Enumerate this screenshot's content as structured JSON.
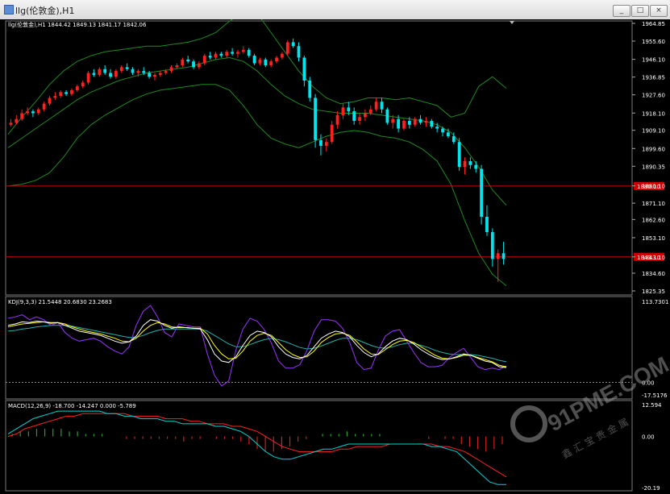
{
  "window": {
    "title": "llg(伦敦金),H1",
    "buttons": [
      "_",
      "□",
      "×"
    ]
  },
  "colors": {
    "background": "#000000",
    "bull": "#ff2020",
    "bear": "#00e5ee",
    "bands": "#1f8a1f",
    "hline": "#cc0000",
    "kdj_k": "#ffffff",
    "kdj_d": "#ffff00",
    "kdj_j": "#9a33ff",
    "kdj_m": "#20b2aa",
    "macd_line": "#00d4d4",
    "macd_signal": "#ff2020",
    "hist_pos": "#2e9a2e",
    "hist_neg": "#cc1f1f"
  },
  "main": {
    "label": "llg(伦敦金),H1  1844.42 1849.13 1841.17 1842.06",
    "hlines": [
      {
        "value": 1880,
        "tag": "1880.10"
      },
      {
        "value": 1843.1,
        "tag": "1843.10"
      }
    ]
  },
  "kdj": {
    "label": "KDJ(9,3,3) 21.5448 20.6830 23.2683"
  },
  "macd": {
    "label": "MACD(12,26,9) -18.700 -14.247 0.000 -5.789"
  },
  "watermark": {
    "text": "91PME.COM",
    "subtext": "鑫 汇 宝 贵 金 属"
  },
  "chart_data": [
    {
      "type": "candlestick",
      "title": "llg(伦敦金),H1",
      "ylim": [
        1825.35,
        1964.85
      ],
      "ticks": [
        1964.85,
        1955.6,
        1946.1,
        1936.85,
        1927.6,
        1918.1,
        1909.1,
        1899.6,
        1890.35,
        1880.1,
        1871.1,
        1862.6,
        1853.1,
        1843.1,
        1834.6,
        1825.35
      ],
      "ohlc": [
        [
          1912,
          1915,
          1911,
          1913
        ],
        [
          1913,
          1917,
          1912,
          1915
        ],
        [
          1915,
          1920,
          1914,
          1918
        ],
        [
          1918,
          1921,
          1917,
          1919
        ],
        [
          1919,
          1920,
          1916,
          1918
        ],
        [
          1918,
          1921,
          1917,
          1920
        ],
        [
          1920,
          1924,
          1919,
          1923
        ],
        [
          1923,
          1927,
          1922,
          1926
        ],
        [
          1926,
          1929,
          1925,
          1927
        ],
        [
          1927,
          1930,
          1926,
          1929
        ],
        [
          1929,
          1930,
          1927,
          1928
        ],
        [
          1928,
          1931,
          1927,
          1930
        ],
        [
          1930,
          1933,
          1929,
          1932
        ],
        [
          1932,
          1935,
          1931,
          1934
        ],
        [
          1934,
          1940,
          1933,
          1939
        ],
        [
          1939,
          1941,
          1937,
          1938
        ],
        [
          1938,
          1942,
          1937,
          1941
        ],
        [
          1941,
          1943,
          1938,
          1939
        ],
        [
          1939,
          1941,
          1936,
          1937
        ],
        [
          1937,
          1941,
          1936,
          1940
        ],
        [
          1940,
          1943,
          1939,
          1942
        ],
        [
          1942,
          1944,
          1940,
          1941
        ],
        [
          1941,
          1942,
          1938,
          1939
        ],
        [
          1939,
          1941,
          1937,
          1940
        ],
        [
          1940,
          1942,
          1938,
          1939
        ],
        [
          1939,
          1940,
          1936,
          1937
        ],
        [
          1937,
          1939,
          1935,
          1938
        ],
        [
          1938,
          1940,
          1937,
          1939
        ],
        [
          1939,
          1941,
          1938,
          1940
        ],
        [
          1940,
          1943,
          1939,
          1942
        ],
        [
          1942,
          1944,
          1941,
          1943
        ],
        [
          1943,
          1947,
          1942,
          1946
        ],
        [
          1946,
          1948,
          1944,
          1945
        ],
        [
          1945,
          1946,
          1941,
          1942
        ],
        [
          1942,
          1945,
          1941,
          1944
        ],
        [
          1944,
          1949,
          1943,
          1948
        ],
        [
          1948,
          1950,
          1946,
          1947
        ],
        [
          1947,
          1950,
          1946,
          1949
        ],
        [
          1949,
          1950,
          1947,
          1948
        ],
        [
          1948,
          1951,
          1947,
          1950
        ],
        [
          1950,
          1952,
          1948,
          1949
        ],
        [
          1949,
          1951,
          1947,
          1950
        ],
        [
          1950,
          1953,
          1949,
          1951
        ],
        [
          1951,
          1952,
          1947,
          1948
        ],
        [
          1948,
          1949,
          1943,
          1944
        ],
        [
          1944,
          1947,
          1943,
          1946
        ],
        [
          1946,
          1947,
          1942,
          1943
        ],
        [
          1943,
          1946,
          1942,
          1945
        ],
        [
          1945,
          1948,
          1944,
          1947
        ],
        [
          1947,
          1950,
          1946,
          1949
        ],
        [
          1949,
          1956,
          1948,
          1955
        ],
        [
          1955,
          1957,
          1952,
          1953
        ],
        [
          1953,
          1955,
          1945,
          1947
        ],
        [
          1947,
          1948,
          1932,
          1935
        ],
        [
          1935,
          1937,
          1924,
          1926
        ],
        [
          1926,
          1928,
          1900,
          1904
        ],
        [
          1904,
          1907,
          1896,
          1901
        ],
        [
          1901,
          1905,
          1898,
          1903
        ],
        [
          1903,
          1914,
          1902,
          1912
        ],
        [
          1912,
          1919,
          1910,
          1917
        ],
        [
          1917,
          1923,
          1915,
          1921
        ],
        [
          1921,
          1924,
          1917,
          1919
        ],
        [
          1919,
          1921,
          1912,
          1914
        ],
        [
          1914,
          1918,
          1912,
          1916
        ],
        [
          1916,
          1920,
          1914,
          1918
        ],
        [
          1918,
          1922,
          1917,
          1920
        ],
        [
          1920,
          1926,
          1919,
          1924
        ],
        [
          1924,
          1926,
          1918,
          1920
        ],
        [
          1920,
          1921,
          1912,
          1913
        ],
        [
          1913,
          1917,
          1910,
          1915
        ],
        [
          1915,
          1917,
          1908,
          1910
        ],
        [
          1910,
          1915,
          1909,
          1914
        ],
        [
          1914,
          1916,
          1910,
          1912
        ],
        [
          1912,
          1916,
          1911,
          1915
        ],
        [
          1915,
          1917,
          1912,
          1913
        ],
        [
          1913,
          1916,
          1911,
          1914
        ],
        [
          1914,
          1915,
          1910,
          1911
        ],
        [
          1911,
          1913,
          1908,
          1910
        ],
        [
          1910,
          1911,
          1906,
          1908
        ],
        [
          1908,
          1910,
          1905,
          1906
        ],
        [
          1906,
          1908,
          1902,
          1903
        ],
        [
          1903,
          1905,
          1888,
          1890
        ],
        [
          1890,
          1895,
          1886,
          1893
        ],
        [
          1893,
          1895,
          1889,
          1891
        ],
        [
          1891,
          1893,
          1887,
          1889
        ],
        [
          1889,
          1891,
          1860,
          1864
        ],
        [
          1864,
          1870,
          1854,
          1856
        ],
        [
          1856,
          1858,
          1838,
          1842
        ],
        [
          1842,
          1847,
          1830,
          1845
        ],
        [
          1845,
          1851,
          1839,
          1842
        ]
      ],
      "bollinger": {
        "upper": [
          1907,
          1916,
          1924,
          1933,
          1940,
          1945,
          1948,
          1950,
          1951,
          1952,
          1953,
          1953,
          1954,
          1955,
          1957,
          1960,
          1966,
          1971,
          1970,
          1960,
          1950,
          1940,
          1932,
          1926,
          1923,
          1924,
          1926,
          1926,
          1925,
          1926,
          1924,
          1922,
          1916,
          1918,
          1932,
          1937,
          1931
        ],
        "middle": [
          1900,
          1905,
          1910,
          1915,
          1920,
          1925,
          1929,
          1932,
          1935,
          1937,
          1939,
          1940,
          1941,
          1942,
          1944,
          1946,
          1947,
          1945,
          1940,
          1933,
          1927,
          1923,
          1920,
          1919,
          1918,
          1918,
          1918,
          1917,
          1916,
          1915,
          1914,
          1912,
          1908,
          1900,
          1890,
          1878,
          1870
        ],
        "lower": [
          1880,
          1881,
          1883,
          1887,
          1895,
          1905,
          1912,
          1917,
          1921,
          1925,
          1928,
          1930,
          1931,
          1932,
          1933,
          1933,
          1930,
          1922,
          1912,
          1905,
          1902,
          1900,
          1903,
          1906,
          1908,
          1909,
          1908,
          1906,
          1905,
          1903,
          1899,
          1893,
          1881,
          1862,
          1845,
          1834,
          1828
        ]
      }
    },
    {
      "type": "line",
      "title": "KDJ(9,3,3)",
      "ylim": [
        -17.5176,
        113.7301
      ],
      "ticks": [
        113.7301,
        0.0,
        -17.5176
      ],
      "series": [
        {
          "name": "K",
          "values": [
            80,
            82,
            85,
            84,
            86,
            85,
            83,
            84,
            80,
            76,
            72,
            70,
            68,
            66,
            62,
            58,
            55,
            57,
            65,
            80,
            88,
            86,
            80,
            76,
            78,
            77,
            76,
            75,
            60,
            40,
            30,
            28,
            36,
            52,
            66,
            72,
            70,
            64,
            50,
            40,
            35,
            33,
            38,
            50,
            62,
            68,
            72,
            70,
            64,
            52,
            42,
            36,
            40,
            50,
            58,
            62,
            60,
            54,
            46,
            40,
            35,
            32,
            33,
            36,
            40,
            38,
            34,
            30,
            28,
            22,
            21
          ]
        },
        {
          "name": "D",
          "values": [
            78,
            80,
            82,
            83,
            84,
            85,
            84,
            84,
            82,
            78,
            75,
            72,
            70,
            68,
            65,
            62,
            58,
            57,
            62,
            72,
            80,
            84,
            82,
            78,
            77,
            77,
            76,
            76,
            68,
            52,
            40,
            33,
            34,
            44,
            58,
            66,
            69,
            66,
            56,
            46,
            39,
            35,
            36,
            44,
            56,
            63,
            68,
            69,
            66,
            57,
            47,
            40,
            39,
            46,
            53,
            58,
            59,
            56,
            50,
            44,
            38,
            34,
            33,
            35,
            38,
            38,
            35,
            32,
            29,
            24,
            22
          ]
        },
        {
          "name": "J",
          "values": [
            90,
            92,
            95,
            88,
            92,
            88,
            80,
            84,
            70,
            62,
            58,
            60,
            62,
            58,
            50,
            44,
            40,
            50,
            80,
            100,
            108,
            92,
            70,
            64,
            82,
            80,
            78,
            78,
            40,
            10,
            -5,
            2,
            45,
            75,
            90,
            86,
            74,
            55,
            30,
            20,
            20,
            25,
            45,
            72,
            88,
            88,
            86,
            76,
            56,
            28,
            18,
            20,
            45,
            65,
            72,
            74,
            58,
            42,
            28,
            22,
            22,
            24,
            35,
            42,
            48,
            35,
            22,
            18,
            20,
            18,
            23
          ]
        },
        {
          "name": "M",
          "values": [
            72,
            73,
            75,
            76,
            78,
            79,
            80,
            80,
            80,
            79,
            77,
            75,
            73,
            71,
            69,
            67,
            65,
            63,
            63,
            66,
            70,
            73,
            75,
            75,
            75,
            75,
            75,
            75,
            72,
            66,
            60,
            54,
            50,
            50,
            53,
            57,
            60,
            62,
            60,
            57,
            53,
            49,
            47,
            48,
            51,
            55,
            59,
            62,
            62,
            60,
            56,
            52,
            49,
            48,
            50,
            53,
            55,
            55,
            52,
            49,
            45,
            42,
            40,
            39,
            39,
            39,
            38,
            36,
            34,
            31,
            29
          ]
        }
      ]
    },
    {
      "type": "line",
      "title": "MACD(12,26,9)",
      "ylim": [
        -20.19,
        12.594
      ],
      "ticks": [
        12.594,
        0.0,
        -20.19
      ],
      "series": [
        {
          "name": "MACD",
          "values": [
            1,
            3,
            5,
            7,
            8,
            9,
            10,
            10,
            10,
            10,
            10,
            10,
            9,
            9,
            8,
            8,
            7,
            7,
            7,
            6,
            6,
            5,
            5,
            5,
            5,
            4,
            4,
            3,
            2,
            0,
            -3,
            -6,
            -8,
            -9,
            -9,
            -8,
            -7,
            -6,
            -5,
            -5,
            -4,
            -3,
            -3,
            -3,
            -3,
            -3,
            -3,
            -3,
            -3,
            -3,
            -3,
            -4,
            -4,
            -5,
            -6,
            -9,
            -12,
            -15,
            -18,
            -19,
            -19
          ]
        },
        {
          "name": "Signal",
          "values": [
            0,
            1,
            3,
            4,
            5,
            6,
            7,
            8,
            8,
            9,
            9,
            9,
            9,
            9,
            9,
            8,
            8,
            8,
            8,
            7,
            7,
            7,
            6,
            6,
            5,
            5,
            5,
            4,
            4,
            3,
            2,
            0,
            -2,
            -4,
            -5,
            -6,
            -6,
            -6,
            -6,
            -6,
            -5,
            -5,
            -4,
            -4,
            -4,
            -4,
            -3,
            -3,
            -3,
            -3,
            -3,
            -3,
            -4,
            -4,
            -5,
            -6,
            -8,
            -10,
            -12,
            -14,
            -16
          ]
        },
        {
          "name": "Histogram",
          "values": [
            1,
            2,
            2,
            3,
            3,
            3,
            3,
            2,
            2,
            1,
            1,
            1,
            0,
            0,
            -1,
            -1,
            -1,
            -1,
            -1,
            -1,
            -1,
            -2,
            -1,
            -1,
            0,
            -1,
            -1,
            -1,
            -2,
            -3,
            -5,
            -6,
            -6,
            -5,
            -4,
            -2,
            -1,
            0,
            1,
            1,
            1,
            2,
            1,
            1,
            1,
            1,
            0,
            0,
            0,
            0,
            0,
            -1,
            0,
            -1,
            -1,
            -3,
            -4,
            -5,
            -6,
            -5,
            -3
          ]
        }
      ]
    }
  ]
}
